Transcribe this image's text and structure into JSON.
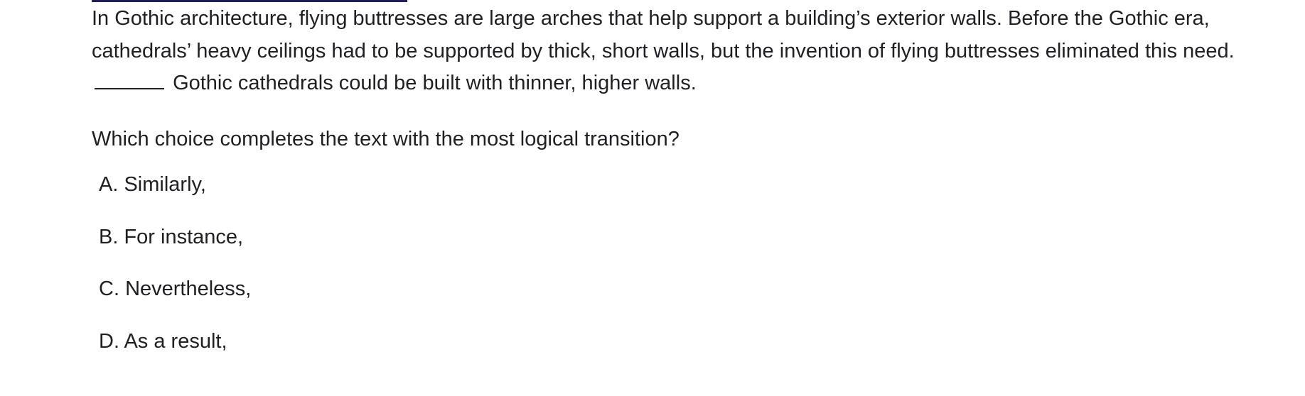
{
  "passage": {
    "before_blank": "In Gothic architecture, flying buttresses are large arches that help support a building’s exterior walls. Before the Gothic era, cathedrals’ heavy ceilings had to be supported by thick, short walls, but the invention of flying buttresses eliminated this need.",
    "after_blank": "Gothic cathedrals could be built with thinner, higher walls."
  },
  "question": "Which choice completes the text with the most logical transition?",
  "choices": [
    {
      "label": "A.",
      "text": "Similarly,"
    },
    {
      "label": "B.",
      "text": "For instance,"
    },
    {
      "label": "C.",
      "text": "Nevertheless,"
    },
    {
      "label": "D.",
      "text": "As a result,"
    }
  ]
}
